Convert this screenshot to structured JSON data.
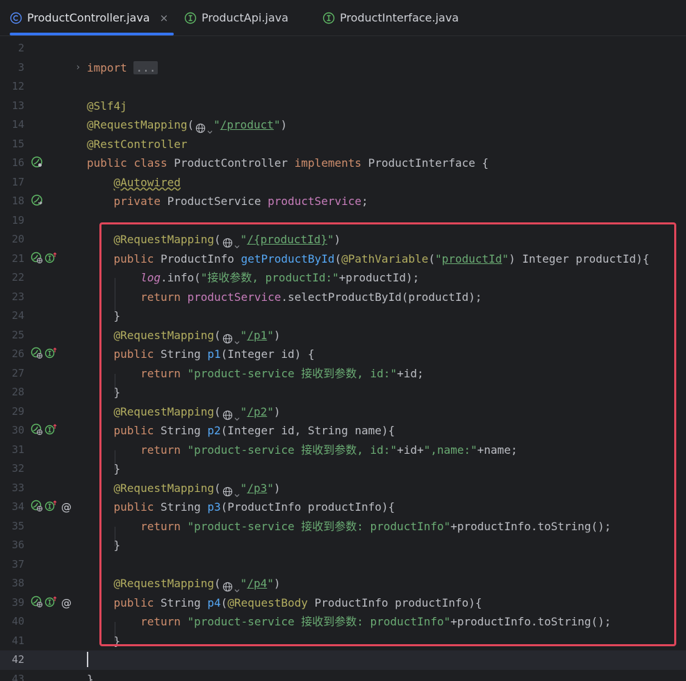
{
  "tabs": [
    {
      "label": "ProductController.java",
      "icon": "class-icon",
      "active": true
    },
    {
      "label": "ProductApi.java",
      "icon": "interface-icon",
      "active": false
    },
    {
      "label": "ProductInterface.java",
      "icon": "interface-icon",
      "active": false
    }
  ],
  "tab_close": "×",
  "colors": {
    "accent": "#3574f0",
    "highlight_box": "#e0465a",
    "keyword": "#cf8e6d",
    "annotation": "#b3ae60",
    "string": "#6aab73",
    "method": "#56a8f5",
    "field": "#c77dbb"
  },
  "lines": {
    "n2": "2",
    "n3": "3",
    "n12": "12",
    "n13": "13",
    "n14": "14",
    "n15": "15",
    "n16": "16",
    "n17": "17",
    "n18": "18",
    "n19": "19",
    "n20": "20",
    "n21": "21",
    "n22": "22",
    "n23": "23",
    "n24": "24",
    "n25": "25",
    "n26": "26",
    "n27": "27",
    "n28": "28",
    "n29": "29",
    "n30": "30",
    "n31": "31",
    "n32": "32",
    "n33": "33",
    "n34": "34",
    "n35": "35",
    "n36": "36",
    "n37": "37",
    "n38": "38",
    "n39": "39",
    "n40": "40",
    "n41": "41",
    "n42": "42",
    "n43": "43"
  },
  "code": {
    "import_kw": "import",
    "import_fold": "...",
    "slf4j": "@Slf4j",
    "rm": "@RequestMapping",
    "paren_open": "(",
    "paren_close": ")",
    "quote": "\"",
    "path_product": "/product",
    "rest": "@RestController",
    "public": "public",
    "class": "class",
    "class_name": "ProductController",
    "implements": "implements",
    "iface": "ProductInterface {",
    "autowired": "@Autowired",
    "private": "private",
    "svc_type": "ProductService",
    "svc_field": "productService",
    "semi": ";",
    "path_pid": "/{productId}",
    "ret_info": "ProductInfo",
    "m_get": "getProductById",
    "pathvar": "@PathVariable",
    "pv_name": "productId",
    "pv_rest": ") Integer productId){",
    "log": "log",
    "info_call": ".info(",
    "log_str": "\"接收参数, productId:\"",
    "log_tail": "+productId);",
    "return": "return",
    "select_call": ".selectProductById(productId);",
    "close_brace": "}",
    "path_p1": "/p1",
    "string_t": "String",
    "m_p1": "p1",
    "p1_params": "(Integer id) {",
    "str_id": "\"product-service 接收到参数, id:\"",
    "tail_id": "+id;",
    "path_p2": "/p2",
    "m_p2": "p2",
    "p2_params": "(Integer id, String name){",
    "str_name": "\",name:\"",
    "tail_name_mid": "+id+",
    "tail_name": "+name;",
    "path_p3": "/p3",
    "m_p3": "p3",
    "p3_params": "(ProductInfo productInfo){",
    "str_pi": "\"product-service 接收到参数: productInfo\"",
    "tail_pi": "+productInfo.toString();",
    "path_p4": "/p4",
    "m_p4": "p4",
    "reqbody": "@RequestBody",
    "p4_params": " ProductInfo productInfo){",
    "at_sign": "@"
  }
}
